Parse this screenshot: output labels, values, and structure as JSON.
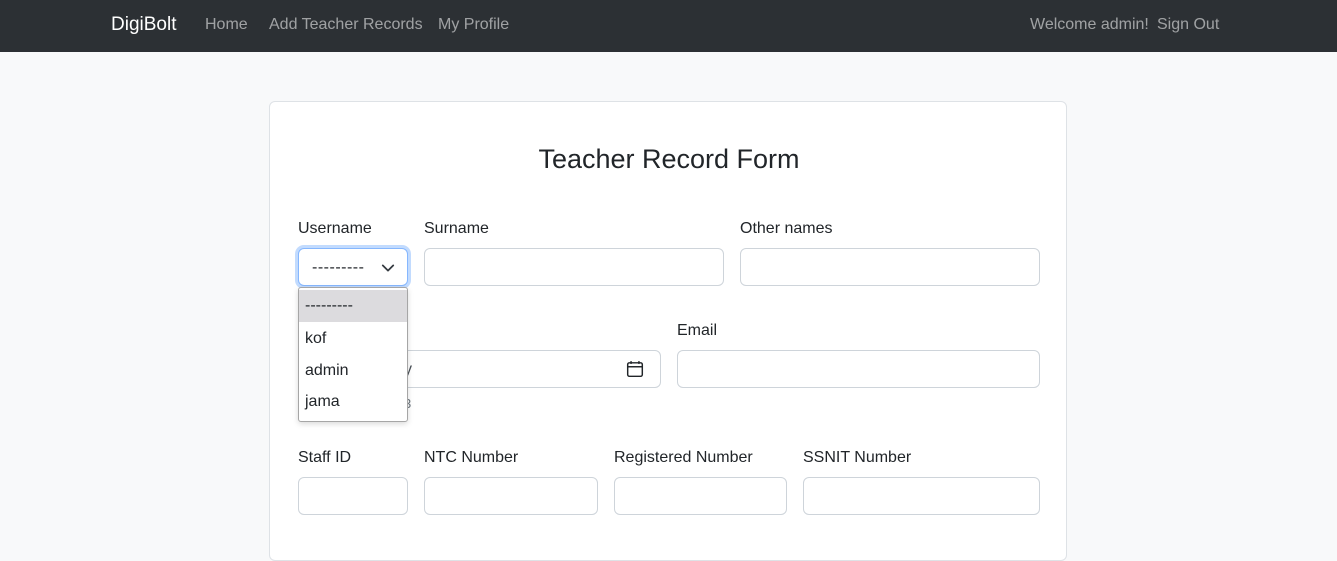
{
  "navbar": {
    "brand": "DigiBolt",
    "links": [
      "Home",
      "Add Teacher Records",
      "My Profile"
    ],
    "welcome": "Welcome admin!",
    "sign_out": "Sign Out"
  },
  "form": {
    "title": "Teacher Record Form",
    "labels": {
      "username": "Username",
      "surname": "Surname",
      "other_names": "Other names",
      "email": "Email",
      "staff_id": "Staff ID",
      "ntc_number": "NTC Number",
      "registered_number": "Registered Number",
      "ssnit_number": "SSNIT Number"
    },
    "username_select": {
      "value": "---------",
      "options": [
        "---------",
        "kof",
        "admin",
        "jama"
      ],
      "selected_index": 0
    },
    "date_field": {
      "visible_fragment": "y",
      "help_fragment": "3"
    }
  },
  "colors": {
    "navbar_bg": "#2c3034",
    "page_bg": "#f8f9fa",
    "focus_border": "#86b7fe"
  }
}
